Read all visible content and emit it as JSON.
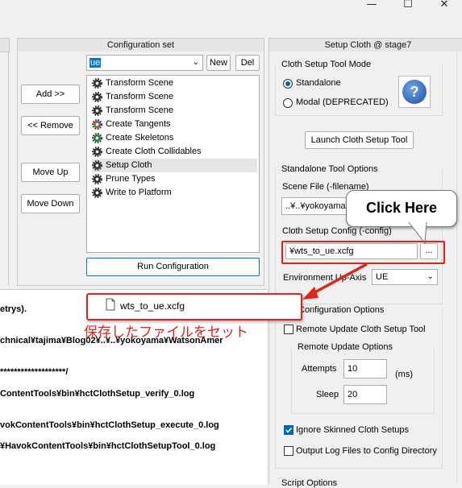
{
  "window": {
    "minimize_glyph": "—",
    "maximize_glyph": "☐",
    "close_glyph": "✕"
  },
  "config_set": {
    "header": "Configuration set",
    "dropdown_value": "ue",
    "new_label": "New",
    "del_label": "Del",
    "items": [
      {
        "label": "Transform Scene",
        "icon": "gear-icon"
      },
      {
        "label": "Transform Scene",
        "icon": "gear-icon"
      },
      {
        "label": "Transform Scene",
        "icon": "gear-icon"
      },
      {
        "label": "Create Tangents",
        "icon": "colored-gear-icon"
      },
      {
        "label": "Create Skeletons",
        "icon": "green-gear-icon"
      },
      {
        "label": "Create Cloth Collidables",
        "icon": "gear-icon"
      },
      {
        "label": "Setup Cloth",
        "icon": "gear-icon"
      },
      {
        "label": "Prune Types",
        "icon": "gear-icon"
      },
      {
        "label": "Write to Platform",
        "icon": "gear-icon"
      }
    ],
    "run_label": "Run Configuration"
  },
  "side_buttons": {
    "add": "Add >>",
    "remove": "<< Remove",
    "move_up": "Move Up",
    "move_down": "Move Down"
  },
  "cloth": {
    "header": "Setup Cloth @ stage7",
    "mode_title": "Cloth Setup Tool Mode",
    "standalone": "Standalone",
    "modal": "Modal (DEPRECATED)",
    "help_glyph": "?",
    "launch": "Launch Cloth Setup Tool",
    "standalone_opts": "Standalone Tool Options",
    "scene_file_label": "Scene File (-filename)",
    "scene_file_value": "..¥..¥yokoyama",
    "config_label": "Cloth Setup Config (-config)",
    "config_value": "¥wts_to_ue.xcfg",
    "browse": "...",
    "env_label": "Environment Up-Axis",
    "env_value": "UE",
    "config_opts": "Configuration Options",
    "remote_update": "Remote Update Cloth Setup Tool",
    "remote_opts": "Remote Update Options",
    "attempts_label": "Attempts",
    "attempts_value": "10",
    "ms": "(ms)",
    "sleep_label": "Sleep",
    "sleep_value": "20",
    "ignore_skinned": "Ignore Skinned Cloth Setups",
    "output_log": "Output Log Files to Config Directory",
    "script_opts": "Script Options"
  },
  "log": [
    "etrys).",
    "chnical¥tajima¥Blog02¥..¥..¥yokoyama¥WatsonAmer",
    "*******************/",
    "ContentTools¥bin¥hctClothSetup_verify_0.log",
    "vokContentTools¥bin¥hctClothSetup_execute_0.log",
    "¥HavokContentTools¥bin¥hctClothSetupTool_0.log"
  ],
  "annotation": {
    "click_here": "Click Here",
    "file_name": "wts_to_ue.xcfg",
    "caption": "保存したファイルをセット",
    "red": "#e8201a"
  }
}
